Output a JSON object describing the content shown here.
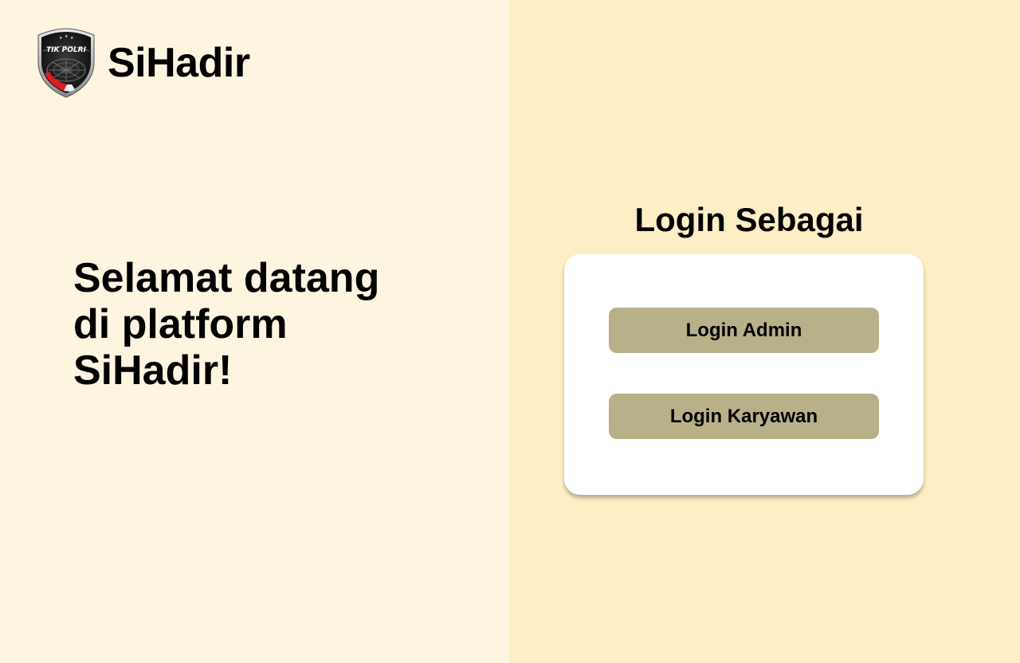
{
  "app": {
    "name": "SiHadir",
    "logo_text": "TIK POLRI"
  },
  "hero": {
    "welcome_text": "Selamat datang di platform SiHadir!"
  },
  "login": {
    "title": "Login Sebagai",
    "admin_label": "Login Admin",
    "karyawan_label": "Login Karyawan"
  },
  "colors": {
    "left_background": "#FEF5E1",
    "right_background": "#FDEEC6",
    "card_background": "#FFFFFF",
    "button_background": "#B8B089",
    "text": "#000000"
  },
  "icons": {
    "logo": "tik-polri-shield-logo"
  }
}
